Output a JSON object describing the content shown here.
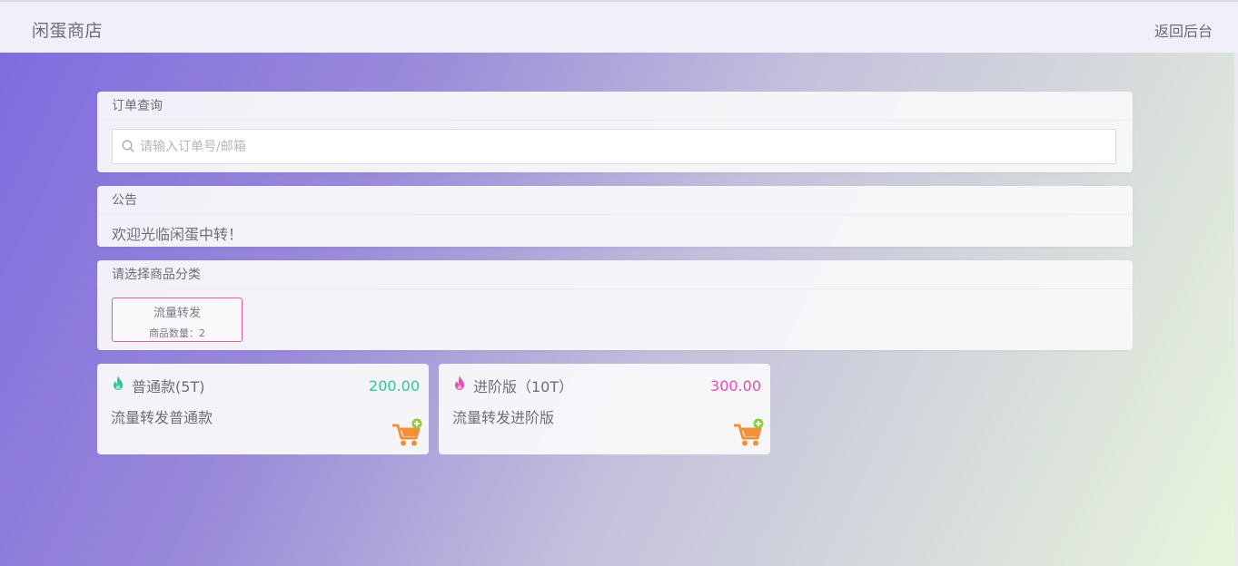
{
  "header": {
    "brand": "闲蛋商店",
    "back_link": "返回后台"
  },
  "order_query": {
    "title": "订单查询",
    "placeholder": "请输入订单号/邮箱",
    "value": ""
  },
  "notice": {
    "title": "公告",
    "text": "欢迎光临闲蛋中转！"
  },
  "categories": {
    "title": "请选择商品分类",
    "items": [
      {
        "name": "流量转发",
        "count_label": "商品数量：2"
      }
    ]
  },
  "products": [
    {
      "name": "普通款(5T)",
      "price": "200.00",
      "description": "流量转发普通款",
      "accent": "#2ec79a",
      "icon": "flame-icon"
    },
    {
      "name": "进阶版（10T）",
      "price": "300.00",
      "description": "流量转发进阶版",
      "accent": "#e84fb3",
      "icon": "flame-icon"
    }
  ],
  "colors": {
    "cart": "#f0913a",
    "cart_plus": "#8ccf3b",
    "category_border": "#e65a9e"
  }
}
